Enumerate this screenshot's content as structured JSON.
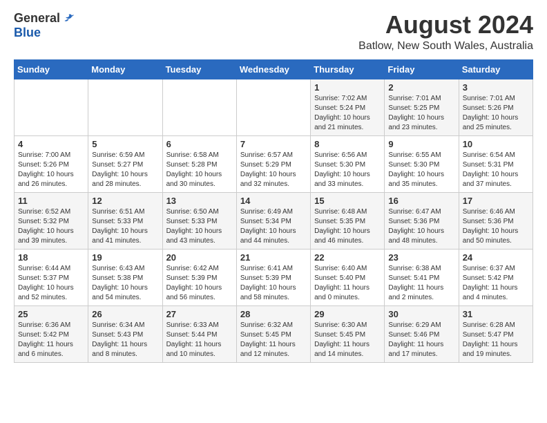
{
  "header": {
    "logo_general": "General",
    "logo_blue": "Blue",
    "month_year": "August 2024",
    "location": "Batlow, New South Wales, Australia"
  },
  "weekdays": [
    "Sunday",
    "Monday",
    "Tuesday",
    "Wednesday",
    "Thursday",
    "Friday",
    "Saturday"
  ],
  "weeks": [
    [
      {
        "day": "",
        "detail": ""
      },
      {
        "day": "",
        "detail": ""
      },
      {
        "day": "",
        "detail": ""
      },
      {
        "day": "",
        "detail": ""
      },
      {
        "day": "1",
        "detail": "Sunrise: 7:02 AM\nSunset: 5:24 PM\nDaylight: 10 hours\nand 21 minutes."
      },
      {
        "day": "2",
        "detail": "Sunrise: 7:01 AM\nSunset: 5:25 PM\nDaylight: 10 hours\nand 23 minutes."
      },
      {
        "day": "3",
        "detail": "Sunrise: 7:01 AM\nSunset: 5:26 PM\nDaylight: 10 hours\nand 25 minutes."
      }
    ],
    [
      {
        "day": "4",
        "detail": "Sunrise: 7:00 AM\nSunset: 5:26 PM\nDaylight: 10 hours\nand 26 minutes."
      },
      {
        "day": "5",
        "detail": "Sunrise: 6:59 AM\nSunset: 5:27 PM\nDaylight: 10 hours\nand 28 minutes."
      },
      {
        "day": "6",
        "detail": "Sunrise: 6:58 AM\nSunset: 5:28 PM\nDaylight: 10 hours\nand 30 minutes."
      },
      {
        "day": "7",
        "detail": "Sunrise: 6:57 AM\nSunset: 5:29 PM\nDaylight: 10 hours\nand 32 minutes."
      },
      {
        "day": "8",
        "detail": "Sunrise: 6:56 AM\nSunset: 5:30 PM\nDaylight: 10 hours\nand 33 minutes."
      },
      {
        "day": "9",
        "detail": "Sunrise: 6:55 AM\nSunset: 5:30 PM\nDaylight: 10 hours\nand 35 minutes."
      },
      {
        "day": "10",
        "detail": "Sunrise: 6:54 AM\nSunset: 5:31 PM\nDaylight: 10 hours\nand 37 minutes."
      }
    ],
    [
      {
        "day": "11",
        "detail": "Sunrise: 6:52 AM\nSunset: 5:32 PM\nDaylight: 10 hours\nand 39 minutes."
      },
      {
        "day": "12",
        "detail": "Sunrise: 6:51 AM\nSunset: 5:33 PM\nDaylight: 10 hours\nand 41 minutes."
      },
      {
        "day": "13",
        "detail": "Sunrise: 6:50 AM\nSunset: 5:33 PM\nDaylight: 10 hours\nand 43 minutes."
      },
      {
        "day": "14",
        "detail": "Sunrise: 6:49 AM\nSunset: 5:34 PM\nDaylight: 10 hours\nand 44 minutes."
      },
      {
        "day": "15",
        "detail": "Sunrise: 6:48 AM\nSunset: 5:35 PM\nDaylight: 10 hours\nand 46 minutes."
      },
      {
        "day": "16",
        "detail": "Sunrise: 6:47 AM\nSunset: 5:36 PM\nDaylight: 10 hours\nand 48 minutes."
      },
      {
        "day": "17",
        "detail": "Sunrise: 6:46 AM\nSunset: 5:36 PM\nDaylight: 10 hours\nand 50 minutes."
      }
    ],
    [
      {
        "day": "18",
        "detail": "Sunrise: 6:44 AM\nSunset: 5:37 PM\nDaylight: 10 hours\nand 52 minutes."
      },
      {
        "day": "19",
        "detail": "Sunrise: 6:43 AM\nSunset: 5:38 PM\nDaylight: 10 hours\nand 54 minutes."
      },
      {
        "day": "20",
        "detail": "Sunrise: 6:42 AM\nSunset: 5:39 PM\nDaylight: 10 hours\nand 56 minutes."
      },
      {
        "day": "21",
        "detail": "Sunrise: 6:41 AM\nSunset: 5:39 PM\nDaylight: 10 hours\nand 58 minutes."
      },
      {
        "day": "22",
        "detail": "Sunrise: 6:40 AM\nSunset: 5:40 PM\nDaylight: 11 hours\nand 0 minutes."
      },
      {
        "day": "23",
        "detail": "Sunrise: 6:38 AM\nSunset: 5:41 PM\nDaylight: 11 hours\nand 2 minutes."
      },
      {
        "day": "24",
        "detail": "Sunrise: 6:37 AM\nSunset: 5:42 PM\nDaylight: 11 hours\nand 4 minutes."
      }
    ],
    [
      {
        "day": "25",
        "detail": "Sunrise: 6:36 AM\nSunset: 5:42 PM\nDaylight: 11 hours\nand 6 minutes."
      },
      {
        "day": "26",
        "detail": "Sunrise: 6:34 AM\nSunset: 5:43 PM\nDaylight: 11 hours\nand 8 minutes."
      },
      {
        "day": "27",
        "detail": "Sunrise: 6:33 AM\nSunset: 5:44 PM\nDaylight: 11 hours\nand 10 minutes."
      },
      {
        "day": "28",
        "detail": "Sunrise: 6:32 AM\nSunset: 5:45 PM\nDaylight: 11 hours\nand 12 minutes."
      },
      {
        "day": "29",
        "detail": "Sunrise: 6:30 AM\nSunset: 5:45 PM\nDaylight: 11 hours\nand 14 minutes."
      },
      {
        "day": "30",
        "detail": "Sunrise: 6:29 AM\nSunset: 5:46 PM\nDaylight: 11 hours\nand 17 minutes."
      },
      {
        "day": "31",
        "detail": "Sunrise: 6:28 AM\nSunset: 5:47 PM\nDaylight: 11 hours\nand 19 minutes."
      }
    ]
  ]
}
